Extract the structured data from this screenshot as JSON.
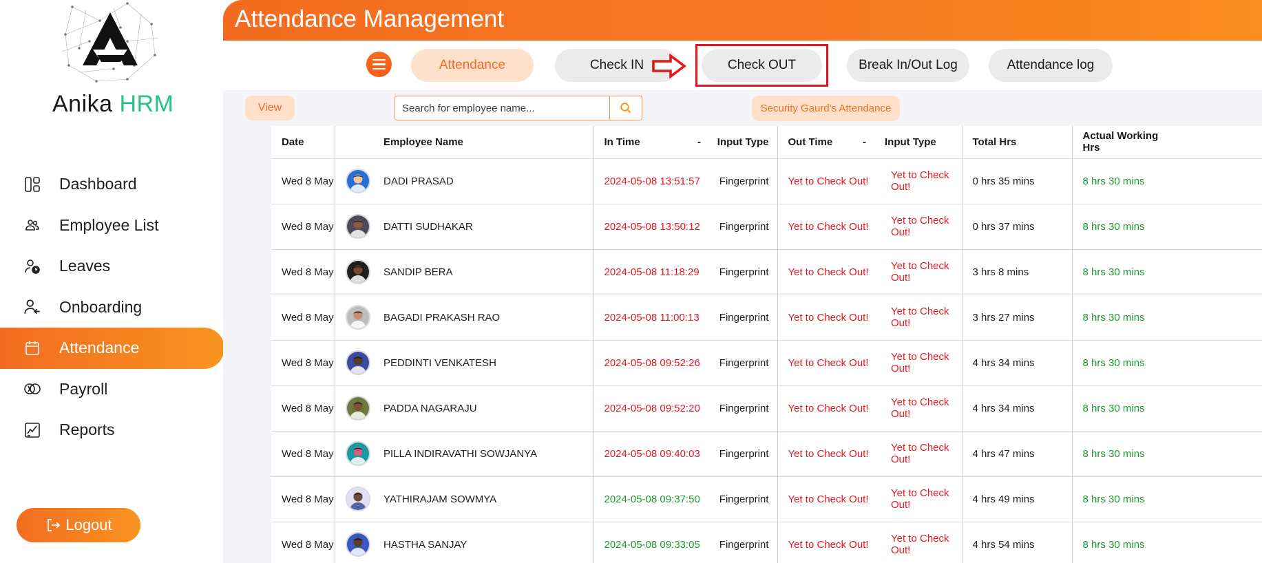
{
  "brand": {
    "name": "Anika ",
    "accent": "HRM"
  },
  "sidebar": {
    "items": [
      {
        "label": "Dashboard",
        "icon": "dashboard-icon"
      },
      {
        "label": "Employee List",
        "icon": "employees-icon"
      },
      {
        "label": "Leaves",
        "icon": "leaves-icon"
      },
      {
        "label": "Onboarding",
        "icon": "onboarding-icon"
      },
      {
        "label": "Attendance",
        "icon": "calendar-icon",
        "active": true
      },
      {
        "label": "Payroll",
        "icon": "payroll-icon"
      },
      {
        "label": "Reports",
        "icon": "reports-icon"
      }
    ],
    "logout_label": "Logout"
  },
  "header": {
    "title": "Attendance Management"
  },
  "toolbar": {
    "tabs": [
      {
        "label": "Attendance",
        "active": true
      },
      {
        "label": "Check IN"
      },
      {
        "label": "Check OUT",
        "highlighted": true
      },
      {
        "label": "Break In/Out Log"
      },
      {
        "label": "Attendance log"
      }
    ]
  },
  "filters": {
    "view_label": "View",
    "search_placeholder": "Search for employee name...",
    "security_label": "Security Gaurd's Attendance"
  },
  "table": {
    "headers": {
      "date": "Date",
      "name": "Employee Name",
      "in_time": "In Time",
      "dash1": "-",
      "input_type": "Input Type",
      "out_time": "Out Time",
      "dash2": "-",
      "input_type2": "Input Type",
      "total": "Total Hrs",
      "actual": "Actual Working Hrs"
    },
    "rows": [
      {
        "date": "Wed 8 May",
        "name": "DADI PRASAD",
        "in_time": "2024-05-08 13:51:57",
        "in_status": "late",
        "input_type": "Fingerprint",
        "out_time": "Yet to Check Out!",
        "out_type": "Yet to Check Out!",
        "total": "0 hrs 35 mins",
        "actual": "8 hrs 30 mins"
      },
      {
        "date": "Wed 8 May",
        "name": "DATTI SUDHAKAR",
        "in_time": "2024-05-08 13:50:12",
        "in_status": "late",
        "input_type": "Fingerprint",
        "out_time": "Yet to Check Out!",
        "out_type": "Yet to Check Out!",
        "total": "0 hrs 37 mins",
        "actual": "8 hrs 30 mins"
      },
      {
        "date": "Wed 8 May",
        "name": "SANDIP BERA",
        "in_time": "2024-05-08 11:18:29",
        "in_status": "late",
        "input_type": "Fingerprint",
        "out_time": "Yet to Check Out!",
        "out_type": "Yet to Check Out!",
        "total": "3 hrs 8 mins",
        "actual": "8 hrs 30 mins"
      },
      {
        "date": "Wed 8 May",
        "name": "BAGADI PRAKASH RAO",
        "in_time": "2024-05-08 11:00:13",
        "in_status": "late",
        "input_type": "Fingerprint",
        "out_time": "Yet to Check Out!",
        "out_type": "Yet to Check Out!",
        "total": "3 hrs 27 mins",
        "actual": "8 hrs 30 mins"
      },
      {
        "date": "Wed 8 May",
        "name": "PEDDINTI VENKATESH",
        "in_time": "2024-05-08 09:52:26",
        "in_status": "late",
        "input_type": "Fingerprint",
        "out_time": "Yet to Check Out!",
        "out_type": "Yet to Check Out!",
        "total": "4 hrs 34 mins",
        "actual": "8 hrs 30 mins"
      },
      {
        "date": "Wed 8 May",
        "name": "PADDA NAGARAJU",
        "in_time": "2024-05-08 09:52:20",
        "in_status": "late",
        "input_type": "Fingerprint",
        "out_time": "Yet to Check Out!",
        "out_type": "Yet to Check Out!",
        "total": "4 hrs 34 mins",
        "actual": "8 hrs 30 mins"
      },
      {
        "date": "Wed 8 May",
        "name": "PILLA INDIRAVATHI SOWJANYA",
        "in_time": "2024-05-08 09:40:03",
        "in_status": "late",
        "input_type": "Fingerprint",
        "out_time": "Yet to Check Out!",
        "out_type": "Yet to Check Out!",
        "total": "4 hrs 47 mins",
        "actual": "8 hrs 30 mins"
      },
      {
        "date": "Wed 8 May",
        "name": "YATHIRAJAM SOWMYA",
        "in_time": "2024-05-08 09:37:50",
        "in_status": "ontime",
        "input_type": "Fingerprint",
        "out_time": "Yet to Check Out!",
        "out_type": "Yet to Check Out!",
        "total": "4 hrs 49 mins",
        "actual": "8 hrs 30 mins"
      },
      {
        "date": "Wed 8 May",
        "name": "HASTHA SANJAY",
        "in_time": "2024-05-08 09:33:05",
        "in_status": "ontime",
        "input_type": "Fingerprint",
        "out_time": "Yet to Check Out!",
        "out_type": "Yet to Check Out!",
        "total": "4 hrs 54 mins",
        "actual": "8 hrs 30 mins"
      }
    ]
  },
  "colors": {
    "accent": "#f36c21",
    "late": "#e11a22",
    "ontime": "#1a9a2f",
    "highlight_box": "#e0161e"
  }
}
